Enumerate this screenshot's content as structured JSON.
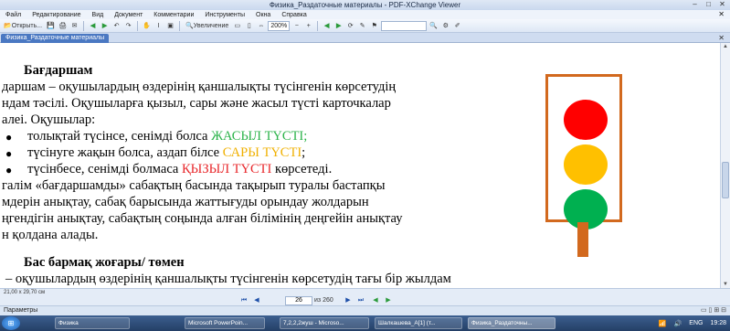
{
  "window": {
    "title": "Физика_Раздаточные материалы - PDF-XChange Viewer",
    "controls": [
      "–",
      "□",
      "✕"
    ]
  },
  "menu": {
    "items": [
      "Файл",
      "Редактирование",
      "Вид",
      "Документ",
      "Комментарии",
      "Инструменты",
      "Окна",
      "Справка"
    ],
    "close": "✕"
  },
  "toolbar": {
    "open_label": "Открыть...",
    "zoom_label": "Увеличение",
    "zoom_value": "200%"
  },
  "doc_tab": {
    "label": "Физика_Раздаточные материалы",
    "close": "✕"
  },
  "document": {
    "heading1": "Бағдаршам",
    "line1": "даршам – оқушылардың өздерінің қаншалықты түсінгенін көрсетудің",
    "line2": "ндам тәсілі. Оқушыларға қызыл, сары және жасыл түсті карточкалар",
    "line3": "алеi. Оқушылар:",
    "bullets": [
      {
        "text_before": "толықтай түсінсе, сенімді болса ",
        "colored": "ЖАСЫЛ ТҮСТІ;",
        "text_after": ""
      },
      {
        "text_before": "түсінуге жақын болса, аздап білсе ",
        "colored": "САРЫ ТҮСТІ",
        "text_after": ";"
      },
      {
        "text_before": "түсінбесе, сенімді болмаса ",
        "colored": "ҚЫЗЫЛ ТҮСТІ",
        "text_after": " көрсетеді."
      }
    ],
    "line4": "галім «бағдаршамды» сабақтың басында тақырып туралы бастапқы",
    "line5": "мдерін анықтау, сабақ барысында жаттығуды орындау жолдарын",
    "line6": "ңгендігін анықтау, сабақтың соңында алған білімінің деңгейін анықтау",
    "line7": "н қолдана алады.",
    "heading2": "Бас бармақ жоғары/ төмен",
    "line8": "– оқушылардың өздерінің қаншалықты түсінгенін көрсетудің тағы бір жылдам"
  },
  "traffic_light": {
    "colors": {
      "top": "#ff0000",
      "middle": "#ffc000",
      "bottom": "#00b050",
      "frame": "#d2691e"
    }
  },
  "status": {
    "page_size": "21,00 x 29,70 см"
  },
  "navigation": {
    "current_page": "26",
    "page_count": "из 260"
  },
  "panel": {
    "params_label": "Параметры"
  },
  "taskbar": {
    "start": "⊞",
    "buttons": [
      {
        "label": "Физика"
      },
      {
        "label": "Microsoft PowerPoin..."
      },
      {
        "label": "7,2,2,2жуш - Microso..."
      },
      {
        "label": "Шалкашева_А[1] (т..."
      },
      {
        "label": "Физика_Раздаточны..."
      }
    ],
    "lang": "ENG",
    "time": "19:28"
  }
}
